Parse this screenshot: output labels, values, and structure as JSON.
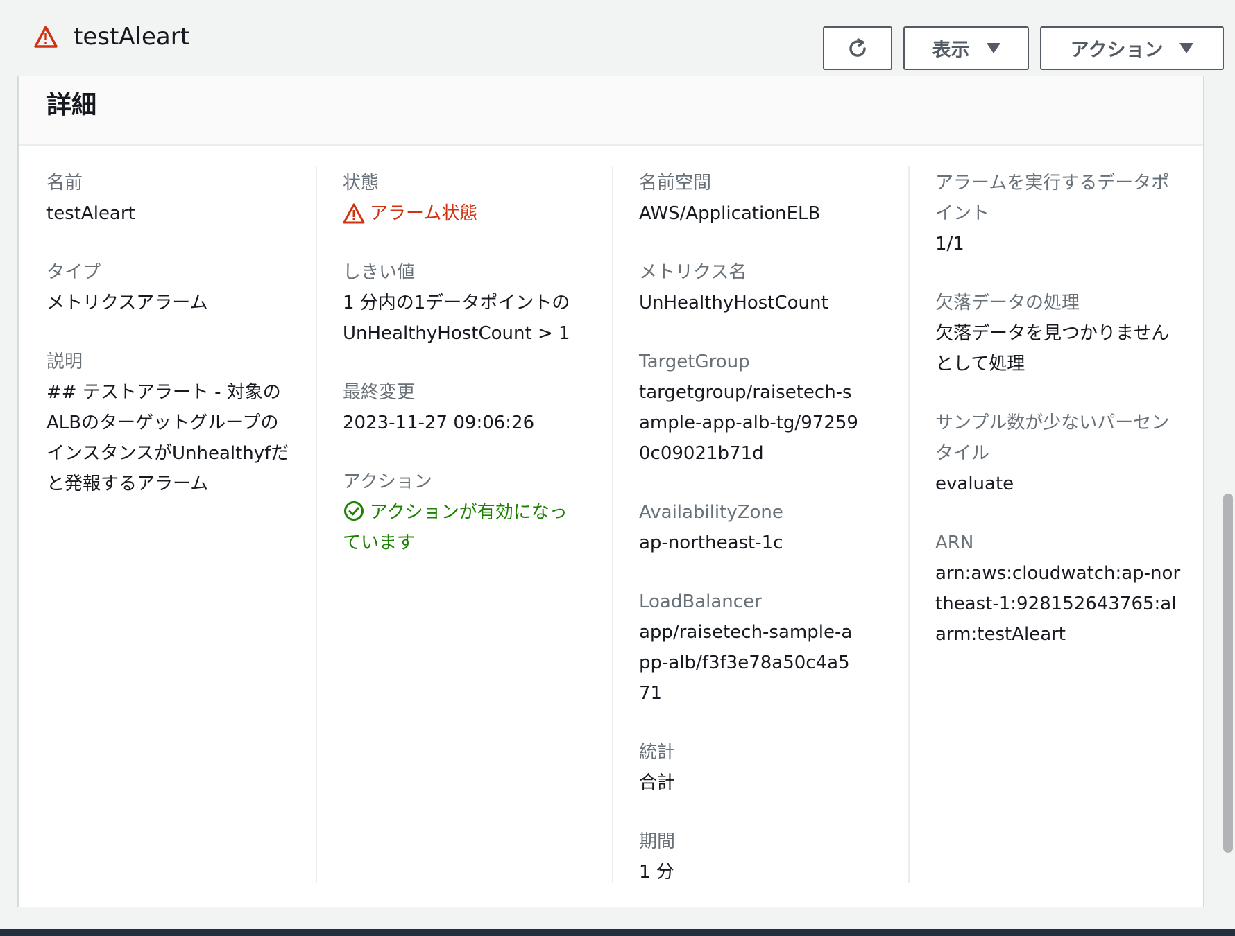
{
  "header": {
    "title": "testAleart",
    "view_label": "表示",
    "actions_label": "アクション"
  },
  "details": {
    "section_title": "詳細",
    "col1": {
      "name_label": "名前",
      "name_value": "testAleart",
      "type_label": "タイプ",
      "type_value": "メトリクスアラーム",
      "desc_label": "説明",
      "desc_value": "## テストアラート - 対象のALBのターゲットグループのインスタンスがUnhealthyfだと発報するアラーム"
    },
    "col2": {
      "state_label": "状態",
      "state_value": "アラーム状態",
      "threshold_label": "しきい値",
      "threshold_value": "1 分内の1データポイントのUnHealthyHostCount > 1",
      "modified_label": "最終変更",
      "modified_value": "2023-11-27 09:06:26",
      "action_label": "アクション",
      "action_value": "アクションが有効になっています"
    },
    "col3": {
      "namespace_label": "名前空間",
      "namespace_value": "AWS/ApplicationELB",
      "metric_label": "メトリクス名",
      "metric_value": "UnHealthyHostCount",
      "tg_label": "TargetGroup",
      "tg_value": "targetgroup/raisetech-sample-app-alb-tg/972590c09021b71d",
      "az_label": "AvailabilityZone",
      "az_value": "ap-northeast-1c",
      "lb_label": "LoadBalancer",
      "lb_value": "app/raisetech-sample-app-alb/f3f3e78a50c4a571",
      "stat_label": "統計",
      "stat_value": "合計",
      "period_label": "期間",
      "period_value": "1 分"
    },
    "col4": {
      "dp_label": "アラームを実行するデータポイント",
      "dp_value": "1/1",
      "missing_label": "欠落データの処理",
      "missing_value": "欠落データを見つかりませんとして処理",
      "pct_label": "サンプル数が少ないパーセンタイル",
      "pct_value": "evaluate",
      "arn_label": "ARN",
      "arn_value": "arn:aws:cloudwatch:ap-northeast-1:928152643765:alarm:testAleart"
    }
  },
  "colors": {
    "alarm": "#d13212",
    "ok": "#1d8102",
    "label": "#687078",
    "text": "#16191f"
  },
  "icons": [
    "warning-icon",
    "refresh-icon",
    "caret-down-icon",
    "check-circle-icon"
  ]
}
